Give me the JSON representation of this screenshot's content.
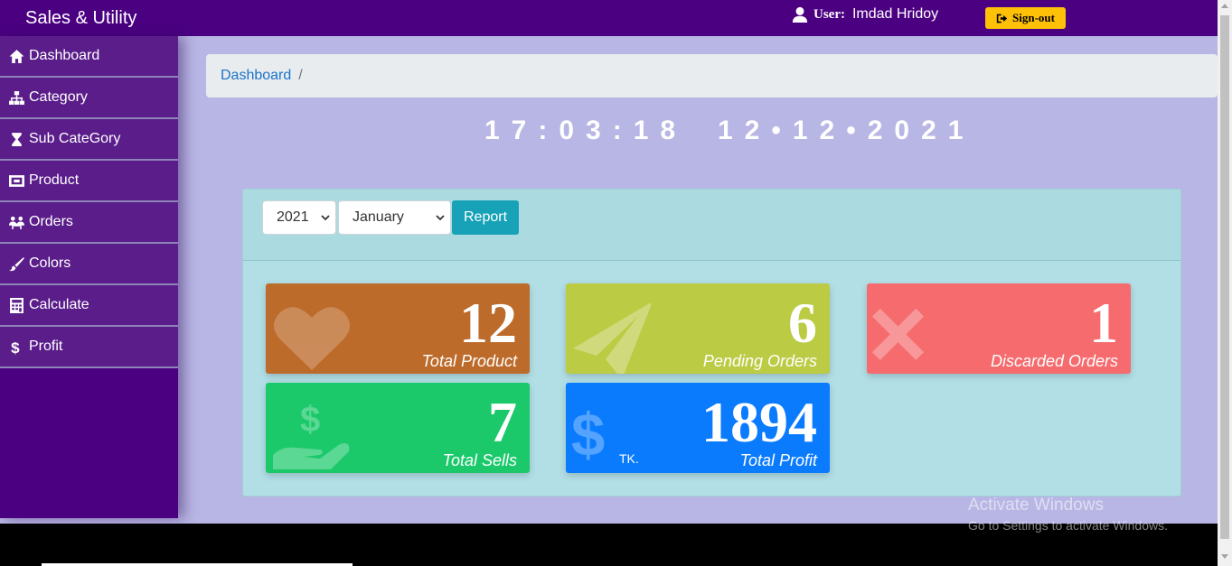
{
  "header": {
    "brand": "Sales & Utility",
    "user_prefix": "User:",
    "user_name": "Imdad Hridoy",
    "signout_label": "Sign-out",
    "signout_color": "#ffc107"
  },
  "sidebar": {
    "items": [
      {
        "label": "Dashboard",
        "icon": "home-icon"
      },
      {
        "label": "Category",
        "icon": "sitemap-icon"
      },
      {
        "label": "Sub CateGory",
        "icon": "hourglass-icon"
      },
      {
        "label": "Product",
        "icon": "product-icon"
      },
      {
        "label": "Orders",
        "icon": "users-icon"
      },
      {
        "label": "Colors",
        "icon": "paintbrush-icon"
      },
      {
        "label": "Calculate",
        "icon": "calculator-icon"
      },
      {
        "label": "Profit",
        "icon": "dollar-icon"
      }
    ]
  },
  "breadcrumb": {
    "items": [
      "Dashboard"
    ],
    "separator": "/"
  },
  "clock": {
    "time": "17:03:18",
    "date": "12•12•2021"
  },
  "report": {
    "year": "2021",
    "month": "January",
    "button_label": "Report"
  },
  "stats": [
    {
      "value": "12",
      "label": "Total Product",
      "icon": "heart-icon",
      "color": "#bd6b2b"
    },
    {
      "value": "6",
      "label": "Pending Orders",
      "icon": "paper-plane-icon",
      "color": "#bccb44"
    },
    {
      "value": "1",
      "label": "Discarded Orders",
      "icon": "close-icon",
      "color": "#f56b6e"
    },
    {
      "value": "7",
      "label": "Total Sells",
      "icon": "hand-dollar-icon",
      "color": "#1bc96b"
    },
    {
      "value": "1894",
      "unit": "TK.",
      "label": "Total Profit",
      "icon": "dollar-icon",
      "color": "#0b7bfe"
    }
  ],
  "watermark": {
    "line1": "Activate Windows",
    "line2": "Go to Settings to activate Windows."
  },
  "colors": {
    "topbar": "#4b0082",
    "main_bg": "#b8b6e4",
    "report_button": "#17a2b8"
  }
}
